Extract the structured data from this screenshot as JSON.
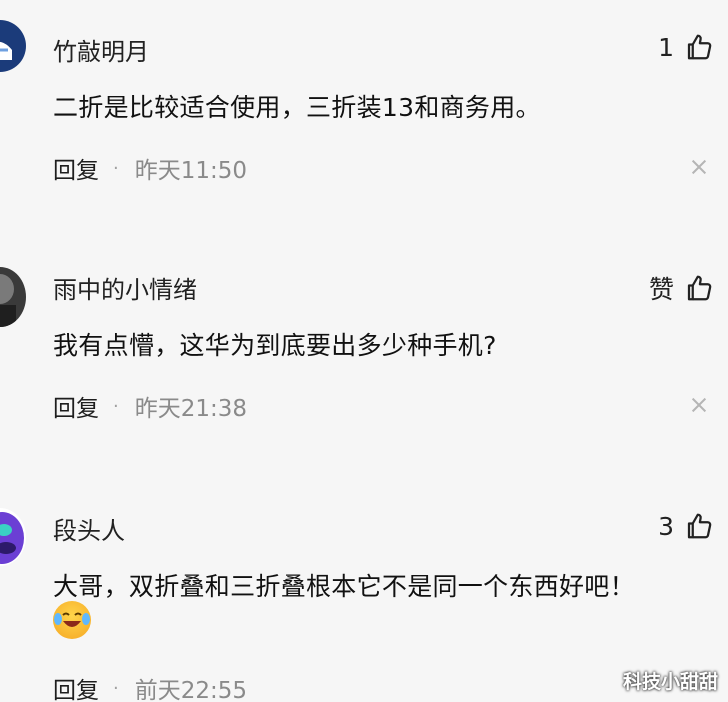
{
  "comments": [
    {
      "username": "竹敲明月",
      "likes": "1",
      "content": "二折是比较适合使用，三折装13和商务用。",
      "reply_label": "回复",
      "separator": "·",
      "time": "昨天11:50",
      "avatar_colors": [
        "#1b3b7a",
        "#ffffff"
      ]
    },
    {
      "username": "雨中的小情绪",
      "likes": "赞",
      "content": "我有点懵，这华为到底要出多少种手机?",
      "reply_label": "回复",
      "separator": "·",
      "time": "昨天21:38",
      "avatar_colors": [
        "#2a2a2a",
        "#777777"
      ]
    },
    {
      "username": "段头人",
      "likes": "3",
      "content": "大哥，双折叠和三折叠根本它不是同一个东西好吧！",
      "reply_label": "回复",
      "separator": "·",
      "time": "前天22:55",
      "avatar_colors": [
        "#6b3fd4",
        "#3ad1c4"
      ]
    }
  ],
  "watermark": "科技小甜甜",
  "icons": {
    "like": "thumbs-up-icon",
    "close": "close-icon",
    "emoji": "laughing-crying-emoji"
  }
}
